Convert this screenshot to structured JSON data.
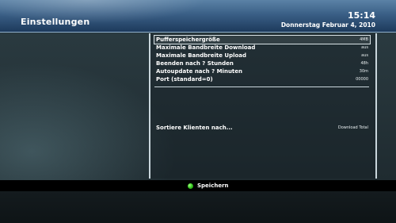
{
  "header": {
    "title": "Einstellungen",
    "time": "15:14",
    "date": "Donnerstag Februar 4, 2010"
  },
  "settings": {
    "items": [
      {
        "label": "Pufferspeichergröße",
        "value": "4MB"
      },
      {
        "label": "Maximale Bandbreite Download",
        "value": "aus"
      },
      {
        "label": "Maximale Bandbreite Upload",
        "value": "aus"
      },
      {
        "label": "Beenden nach ? Stunden",
        "value": "48h"
      },
      {
        "label": "Autoupdate nach ? Minuten",
        "value": "30m"
      },
      {
        "label": "Port (standard=0)",
        "value": "00000"
      }
    ],
    "sort": {
      "label": "Sortiere Klienten nach...",
      "value": "Download Total"
    }
  },
  "footer": {
    "save_label": "Speichern",
    "save_color": "#2fbf1a"
  }
}
